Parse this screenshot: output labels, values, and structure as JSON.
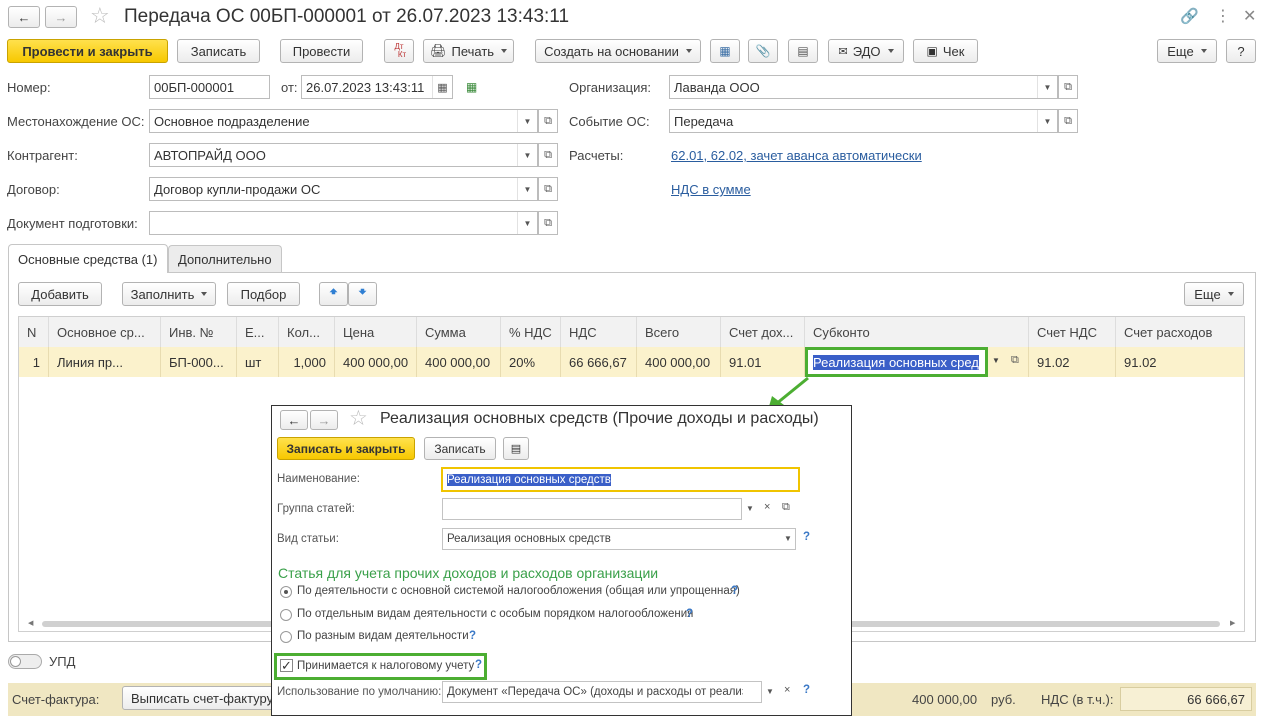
{
  "window": {
    "title": "Передача ОС 00БП-000001 от 26.07.2023 13:43:11"
  },
  "toolbar": {
    "post_close": "Провести и закрыть",
    "save": "Записать",
    "post": "Провести",
    "dtkt_top": "Дт",
    "dtkt_bottom": "Кт",
    "print": "Печать",
    "create_based": "Создать на основании",
    "edo": "ЭДО",
    "check": "Чек",
    "more": "Еще",
    "help": "?"
  },
  "form": {
    "number_label": "Номер:",
    "number_value": "00БП-000001",
    "from_label": "от:",
    "date_value": "26.07.2023 13:43:11",
    "location_label": "Местонахождение ОС:",
    "location_value": "Основное подразделение",
    "contractor_label": "Контрагент:",
    "contractor_value": "АВТОПРАЙД ООО",
    "contract_label": "Договор:",
    "contract_value": "Договор купли-продажи ОС",
    "prep_doc_label": "Документ подготовки:",
    "prep_doc_value": "",
    "org_label": "Организация:",
    "org_value": "Лаванда ООО",
    "event_label": "Событие ОС:",
    "event_value": "Передача",
    "calc_label": "Расчеты:",
    "calc_link": "62.01, 62.02, зачет аванса автоматически",
    "vat_link": "НДС в сумме"
  },
  "tabs": [
    {
      "label": "Основные средства (1)"
    },
    {
      "label": "Дополнительно"
    }
  ],
  "table_toolbar": {
    "add": "Добавить",
    "fill": "Заполнить",
    "select": "Подбор",
    "more": "Еще"
  },
  "table": {
    "columns": [
      "N",
      "Основное ср...",
      "Инв. №",
      "Е...",
      "Кол...",
      "Цена",
      "Сумма",
      "% НДС",
      "НДС",
      "Всего",
      "Счет дох...",
      "Субконто",
      "Счет НДС",
      "Счет расходов"
    ],
    "rows": [
      {
        "n": "1",
        "asset": "Линия пр...",
        "inv": "БП-000...",
        "unit": "шт",
        "qty": "1,000",
        "price": "400 000,00",
        "sum": "400 000,00",
        "vat_rate": "20%",
        "vat": "66 666,67",
        "total": "400 000,00",
        "income_acc": "91.01",
        "subconto": "Реализация основных сред",
        "vat_acc": "91.02",
        "expense_acc": "91.02"
      }
    ]
  },
  "bottom": {
    "upd_label": "УПД",
    "invoice_label": "Счет-фактура:",
    "invoice_button": "Выписать счет-фактуру",
    "total_sum": "400 000,00",
    "currency": "руб.",
    "vat_label": "НДС (в т.ч.):",
    "vat_sum": "66 666,67"
  },
  "popup": {
    "title": "Реализация основных средств (Прочие доходы и расходы)",
    "save_close": "Записать и закрыть",
    "save": "Записать",
    "name_label": "Наименование:",
    "name_value": "Реализация основных средств",
    "group_label": "Группа статей:",
    "group_value": "",
    "kind_label": "Вид статьи:",
    "kind_value": "Реализация основных средств",
    "section_title": "Статья для учета прочих доходов и расходов организации",
    "radio1": "По деятельности с основной системой налогообложения (общая или упрощенная)",
    "radio2": "По отдельным видам деятельности с особым порядком налогообложения",
    "radio3": "По разным видам деятельности",
    "checkbox_label": "Принимается к налоговому учету",
    "default_label": "Использование по умолчанию:",
    "default_value": "Документ «Передача ОС» (доходы и расходы от реализации)",
    "q": "?"
  },
  "colors": {
    "accent_yellow": "#f7c800",
    "highlight_green": "#4cae32",
    "row_highlight": "#fbf2cc",
    "link_blue": "#2a5d9f"
  }
}
